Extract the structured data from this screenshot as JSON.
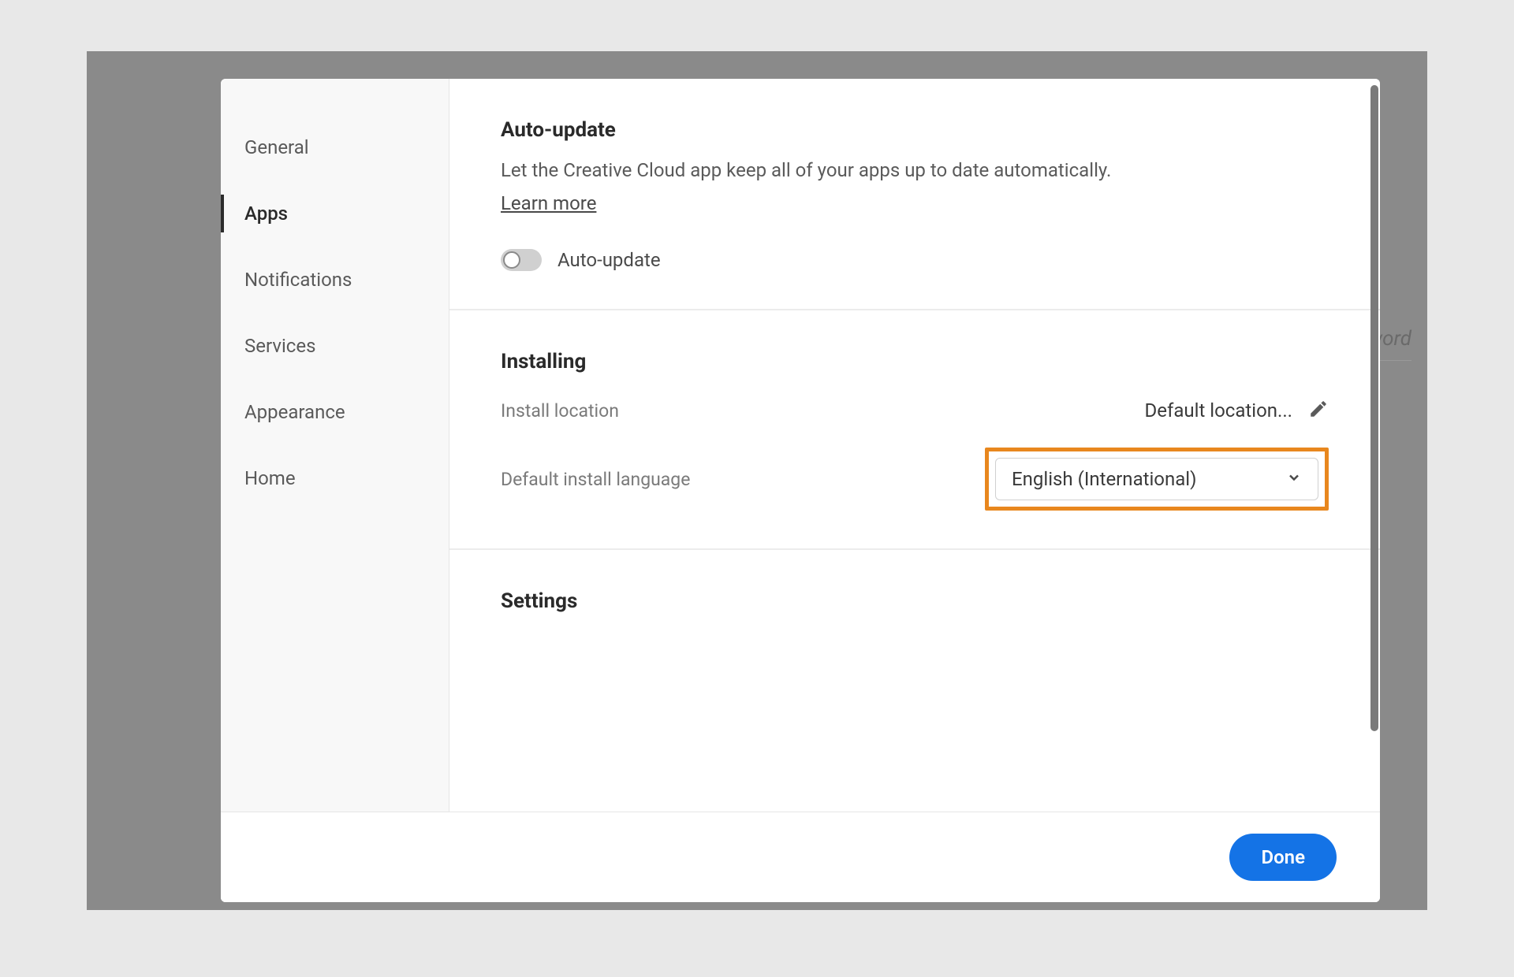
{
  "background": {
    "hint_text": "word"
  },
  "sidebar": {
    "items": [
      {
        "label": "General",
        "active": false
      },
      {
        "label": "Apps",
        "active": true
      },
      {
        "label": "Notifications",
        "active": false
      },
      {
        "label": "Services",
        "active": false
      },
      {
        "label": "Appearance",
        "active": false
      },
      {
        "label": "Home",
        "active": false
      }
    ]
  },
  "sections": {
    "auto_update": {
      "title": "Auto-update",
      "description": "Let the Creative Cloud app keep all of your apps up to date automatically.",
      "learn_more": "Learn more",
      "toggle_label": "Auto-update",
      "toggle_on": false
    },
    "installing": {
      "title": "Installing",
      "install_location_label": "Install location",
      "install_location_value": "Default location...",
      "language_label": "Default install language",
      "language_value": "English (International)"
    },
    "settings": {
      "title": "Settings"
    }
  },
  "footer": {
    "done_label": "Done"
  },
  "colors": {
    "accent": "#1473e6",
    "highlight": "#e8871e"
  }
}
